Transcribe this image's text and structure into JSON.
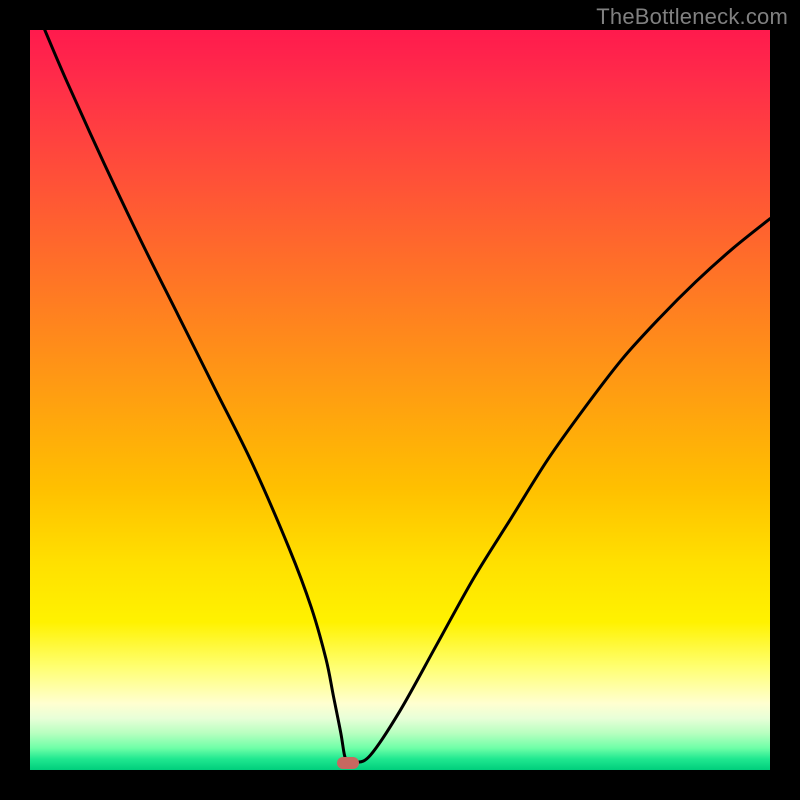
{
  "watermark": "TheBottleneck.com",
  "chart_data": {
    "type": "line",
    "title": "",
    "xlabel": "",
    "ylabel": "",
    "xlim": [
      0,
      100
    ],
    "ylim": [
      0,
      100
    ],
    "grid": false,
    "series": [
      {
        "name": "bottleneck-curve",
        "x": [
          2,
          5,
          10,
          15,
          20,
          25,
          30,
          35,
          38,
          40,
          41,
          42,
          42.5,
          43,
          44,
          46,
          50,
          55,
          60,
          65,
          70,
          75,
          80,
          85,
          90,
          95,
          100
        ],
        "y": [
          100,
          93,
          82,
          71.5,
          61.5,
          51.5,
          41.5,
          30,
          22,
          15,
          10,
          5,
          2,
          1,
          1,
          2,
          8,
          17,
          26,
          34,
          42,
          49,
          55.5,
          61,
          66,
          70.5,
          74.5
        ]
      }
    ],
    "marker": {
      "x": 43,
      "y": 1,
      "color": "#c86860"
    },
    "gradient_stops": [
      {
        "pos": 0.0,
        "color": "#ff1a4d"
      },
      {
        "pos": 0.5,
        "color": "#ffa010"
      },
      {
        "pos": 0.82,
        "color": "#ffff70"
      },
      {
        "pos": 1.0,
        "color": "#00ce7c"
      }
    ]
  }
}
